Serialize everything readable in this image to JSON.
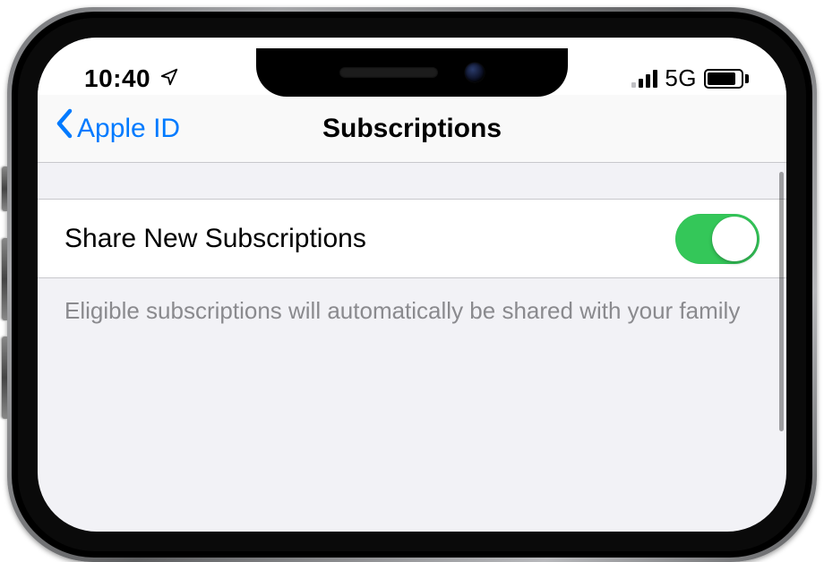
{
  "status": {
    "time": "10:40",
    "network_label": "5G"
  },
  "nav": {
    "back_label": "Apple ID",
    "title": "Subscriptions"
  },
  "setting": {
    "share_label": "Share New Subscriptions",
    "share_on": true,
    "footer_text": "Eligible subscriptions will automatically be shared with your family"
  },
  "colors": {
    "tint": "#007aff",
    "toggle_on": "#34c759"
  }
}
